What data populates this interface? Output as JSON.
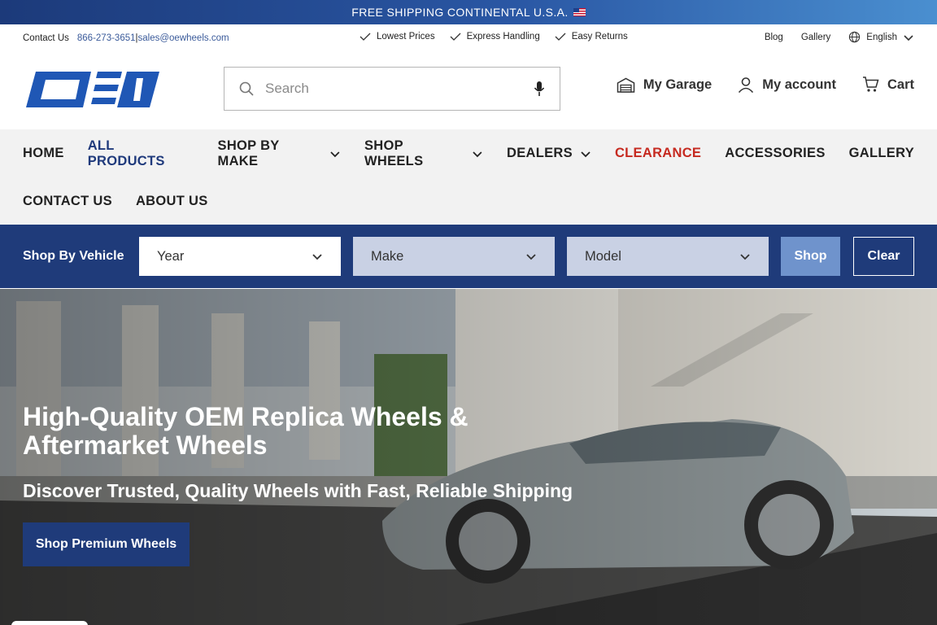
{
  "announcement": {
    "text": "FREE SHIPPING CONTINENTAL U.S.A."
  },
  "utility": {
    "contact_label": "Contact Us",
    "phone": "866-273-3651",
    "separator": "|",
    "email": "sales@oewheels.com",
    "perks": [
      "Lowest Prices",
      "Express Handling",
      "Easy Returns"
    ],
    "blog": "Blog",
    "gallery": "Gallery",
    "language": "English"
  },
  "header": {
    "logo_text": "OEW",
    "search_placeholder": "Search",
    "garage": "My Garage",
    "account": "My account",
    "cart": "Cart"
  },
  "nav": {
    "home": "HOME",
    "all_products": "ALL PRODUCTS",
    "shop_by_make": "SHOP BY MAKE",
    "shop_wheels": "SHOP WHEELS",
    "dealers": "DEALERS",
    "clearance": "CLEARANCE",
    "accessories": "ACCESSORIES",
    "gallery": "GALLERY",
    "contact_us": "CONTACT US",
    "about_us": "ABOUT US"
  },
  "vehicle": {
    "label": "Shop By Vehicle",
    "year": "Year",
    "make": "Make",
    "model": "Model",
    "shop": "Shop",
    "clear": "Clear"
  },
  "hero": {
    "title": "High-Quality OEM Replica Wheels & Aftermarket Wheels",
    "subtitle": "Discover Trusted, Quality Wheels with Fast, Reliable Shipping",
    "cta": "Shop Premium Wheels"
  },
  "colors": {
    "brand_blue": "#1f3b7a",
    "clearance_red": "#c62a20",
    "shop_button": "#6f93cc"
  }
}
